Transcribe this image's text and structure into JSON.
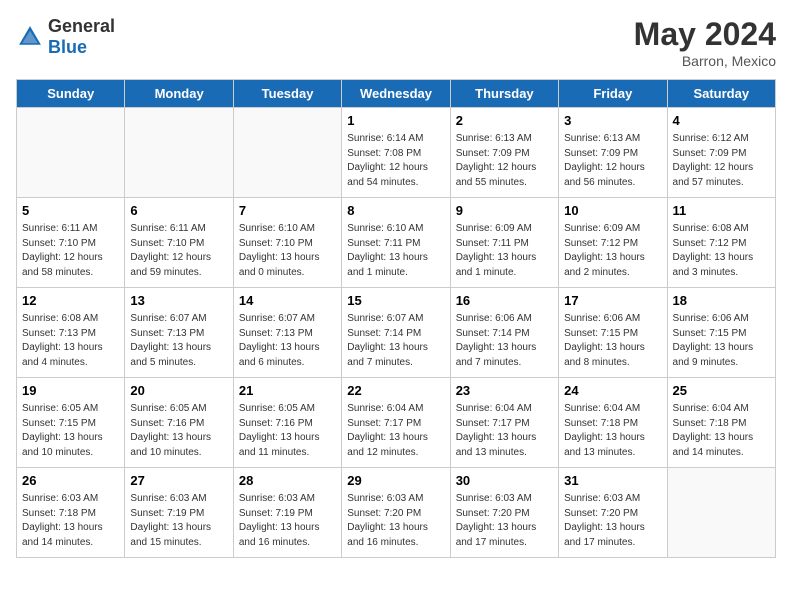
{
  "header": {
    "logo_general": "General",
    "logo_blue": "Blue",
    "title": "May 2024",
    "subtitle": "Barron, Mexico"
  },
  "weekdays": [
    "Sunday",
    "Monday",
    "Tuesday",
    "Wednesday",
    "Thursday",
    "Friday",
    "Saturday"
  ],
  "weeks": [
    [
      {
        "day": "",
        "sunrise": "",
        "sunset": "",
        "daylight": ""
      },
      {
        "day": "",
        "sunrise": "",
        "sunset": "",
        "daylight": ""
      },
      {
        "day": "",
        "sunrise": "",
        "sunset": "",
        "daylight": ""
      },
      {
        "day": "1",
        "sunrise": "Sunrise: 6:14 AM",
        "sunset": "Sunset: 7:08 PM",
        "daylight": "Daylight: 12 hours and 54 minutes."
      },
      {
        "day": "2",
        "sunrise": "Sunrise: 6:13 AM",
        "sunset": "Sunset: 7:09 PM",
        "daylight": "Daylight: 12 hours and 55 minutes."
      },
      {
        "day": "3",
        "sunrise": "Sunrise: 6:13 AM",
        "sunset": "Sunset: 7:09 PM",
        "daylight": "Daylight: 12 hours and 56 minutes."
      },
      {
        "day": "4",
        "sunrise": "Sunrise: 6:12 AM",
        "sunset": "Sunset: 7:09 PM",
        "daylight": "Daylight: 12 hours and 57 minutes."
      }
    ],
    [
      {
        "day": "5",
        "sunrise": "Sunrise: 6:11 AM",
        "sunset": "Sunset: 7:10 PM",
        "daylight": "Daylight: 12 hours and 58 minutes."
      },
      {
        "day": "6",
        "sunrise": "Sunrise: 6:11 AM",
        "sunset": "Sunset: 7:10 PM",
        "daylight": "Daylight: 12 hours and 59 minutes."
      },
      {
        "day": "7",
        "sunrise": "Sunrise: 6:10 AM",
        "sunset": "Sunset: 7:10 PM",
        "daylight": "Daylight: 13 hours and 0 minutes."
      },
      {
        "day": "8",
        "sunrise": "Sunrise: 6:10 AM",
        "sunset": "Sunset: 7:11 PM",
        "daylight": "Daylight: 13 hours and 1 minute."
      },
      {
        "day": "9",
        "sunrise": "Sunrise: 6:09 AM",
        "sunset": "Sunset: 7:11 PM",
        "daylight": "Daylight: 13 hours and 1 minute."
      },
      {
        "day": "10",
        "sunrise": "Sunrise: 6:09 AM",
        "sunset": "Sunset: 7:12 PM",
        "daylight": "Daylight: 13 hours and 2 minutes."
      },
      {
        "day": "11",
        "sunrise": "Sunrise: 6:08 AM",
        "sunset": "Sunset: 7:12 PM",
        "daylight": "Daylight: 13 hours and 3 minutes."
      }
    ],
    [
      {
        "day": "12",
        "sunrise": "Sunrise: 6:08 AM",
        "sunset": "Sunset: 7:13 PM",
        "daylight": "Daylight: 13 hours and 4 minutes."
      },
      {
        "day": "13",
        "sunrise": "Sunrise: 6:07 AM",
        "sunset": "Sunset: 7:13 PM",
        "daylight": "Daylight: 13 hours and 5 minutes."
      },
      {
        "day": "14",
        "sunrise": "Sunrise: 6:07 AM",
        "sunset": "Sunset: 7:13 PM",
        "daylight": "Daylight: 13 hours and 6 minutes."
      },
      {
        "day": "15",
        "sunrise": "Sunrise: 6:07 AM",
        "sunset": "Sunset: 7:14 PM",
        "daylight": "Daylight: 13 hours and 7 minutes."
      },
      {
        "day": "16",
        "sunrise": "Sunrise: 6:06 AM",
        "sunset": "Sunset: 7:14 PM",
        "daylight": "Daylight: 13 hours and 7 minutes."
      },
      {
        "day": "17",
        "sunrise": "Sunrise: 6:06 AM",
        "sunset": "Sunset: 7:15 PM",
        "daylight": "Daylight: 13 hours and 8 minutes."
      },
      {
        "day": "18",
        "sunrise": "Sunrise: 6:06 AM",
        "sunset": "Sunset: 7:15 PM",
        "daylight": "Daylight: 13 hours and 9 minutes."
      }
    ],
    [
      {
        "day": "19",
        "sunrise": "Sunrise: 6:05 AM",
        "sunset": "Sunset: 7:15 PM",
        "daylight": "Daylight: 13 hours and 10 minutes."
      },
      {
        "day": "20",
        "sunrise": "Sunrise: 6:05 AM",
        "sunset": "Sunset: 7:16 PM",
        "daylight": "Daylight: 13 hours and 10 minutes."
      },
      {
        "day": "21",
        "sunrise": "Sunrise: 6:05 AM",
        "sunset": "Sunset: 7:16 PM",
        "daylight": "Daylight: 13 hours and 11 minutes."
      },
      {
        "day": "22",
        "sunrise": "Sunrise: 6:04 AM",
        "sunset": "Sunset: 7:17 PM",
        "daylight": "Daylight: 13 hours and 12 minutes."
      },
      {
        "day": "23",
        "sunrise": "Sunrise: 6:04 AM",
        "sunset": "Sunset: 7:17 PM",
        "daylight": "Daylight: 13 hours and 13 minutes."
      },
      {
        "day": "24",
        "sunrise": "Sunrise: 6:04 AM",
        "sunset": "Sunset: 7:18 PM",
        "daylight": "Daylight: 13 hours and 13 minutes."
      },
      {
        "day": "25",
        "sunrise": "Sunrise: 6:04 AM",
        "sunset": "Sunset: 7:18 PM",
        "daylight": "Daylight: 13 hours and 14 minutes."
      }
    ],
    [
      {
        "day": "26",
        "sunrise": "Sunrise: 6:03 AM",
        "sunset": "Sunset: 7:18 PM",
        "daylight": "Daylight: 13 hours and 14 minutes."
      },
      {
        "day": "27",
        "sunrise": "Sunrise: 6:03 AM",
        "sunset": "Sunset: 7:19 PM",
        "daylight": "Daylight: 13 hours and 15 minutes."
      },
      {
        "day": "28",
        "sunrise": "Sunrise: 6:03 AM",
        "sunset": "Sunset: 7:19 PM",
        "daylight": "Daylight: 13 hours and 16 minutes."
      },
      {
        "day": "29",
        "sunrise": "Sunrise: 6:03 AM",
        "sunset": "Sunset: 7:20 PM",
        "daylight": "Daylight: 13 hours and 16 minutes."
      },
      {
        "day": "30",
        "sunrise": "Sunrise: 6:03 AM",
        "sunset": "Sunset: 7:20 PM",
        "daylight": "Daylight: 13 hours and 17 minutes."
      },
      {
        "day": "31",
        "sunrise": "Sunrise: 6:03 AM",
        "sunset": "Sunset: 7:20 PM",
        "daylight": "Daylight: 13 hours and 17 minutes."
      },
      {
        "day": "",
        "sunrise": "",
        "sunset": "",
        "daylight": ""
      }
    ]
  ]
}
